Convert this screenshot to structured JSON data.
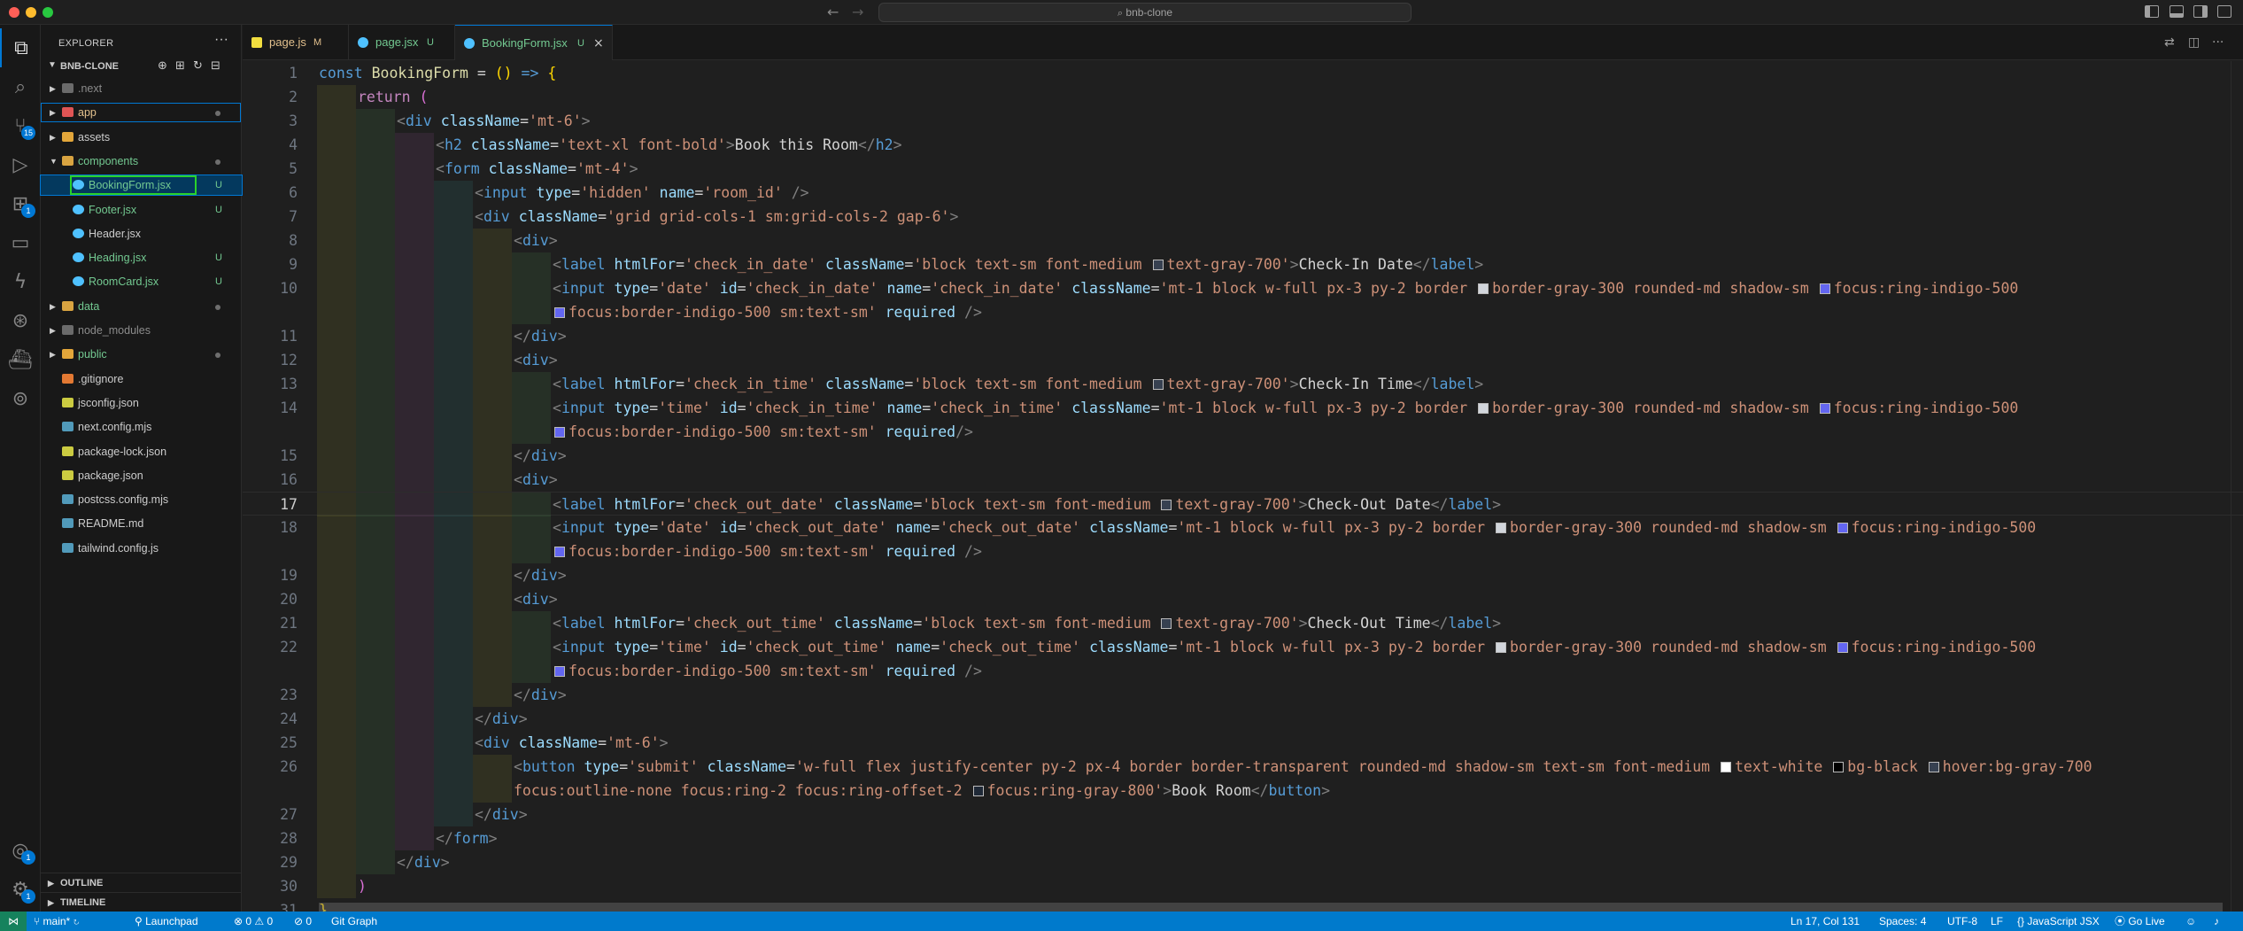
{
  "window": {
    "title": "bnb-clone"
  },
  "activity_bar": {
    "scm_badge": "15",
    "extensions_badge": "1",
    "accounts_badge": "1",
    "settings_badge": "1"
  },
  "explorer": {
    "title": "EXPLORER",
    "root": "BNB-CLONE",
    "items": [
      {
        "label": ".next",
        "type": "folder",
        "depth": 0,
        "expanded": false,
        "color": "#8b8b8b",
        "badge": "",
        "dot": false
      },
      {
        "label": "app",
        "type": "folder",
        "depth": 0,
        "expanded": false,
        "color": "#e2c08d",
        "badge": "",
        "dot": true
      },
      {
        "label": "assets",
        "type": "folder",
        "depth": 0,
        "expanded": false,
        "color": "#cccccc",
        "badge": "",
        "dot": false
      },
      {
        "label": "components",
        "type": "folder",
        "depth": 0,
        "expanded": true,
        "color": "#73c991",
        "badge": "",
        "dot": true
      },
      {
        "label": "BookingForm.jsx",
        "type": "file",
        "depth": 1,
        "color": "#73c991",
        "badge": "U",
        "dot": false
      },
      {
        "label": "Footer.jsx",
        "type": "file",
        "depth": 1,
        "color": "#73c991",
        "badge": "U",
        "dot": false
      },
      {
        "label": "Header.jsx",
        "type": "file",
        "depth": 1,
        "color": "#cccccc",
        "badge": "",
        "dot": false
      },
      {
        "label": "Heading.jsx",
        "type": "file",
        "depth": 1,
        "color": "#73c991",
        "badge": "U",
        "dot": false
      },
      {
        "label": "RoomCard.jsx",
        "type": "file",
        "depth": 1,
        "color": "#73c991",
        "badge": "U",
        "dot": false
      },
      {
        "label": "data",
        "type": "folder",
        "depth": 0,
        "expanded": false,
        "color": "#73c991",
        "badge": "",
        "dot": true
      },
      {
        "label": "node_modules",
        "type": "folder",
        "depth": 0,
        "expanded": false,
        "color": "#8b8b8b",
        "badge": "",
        "dot": false
      },
      {
        "label": "public",
        "type": "folder",
        "depth": 0,
        "expanded": false,
        "color": "#73c991",
        "badge": "",
        "dot": true
      },
      {
        "label": ".gitignore",
        "type": "file",
        "depth": 0,
        "color": "#cccccc",
        "badge": "",
        "dot": false
      },
      {
        "label": "jsconfig.json",
        "type": "file",
        "depth": 0,
        "color": "#cccccc",
        "badge": "",
        "dot": false
      },
      {
        "label": "next.config.mjs",
        "type": "file",
        "depth": 0,
        "color": "#cccccc",
        "badge": "",
        "dot": false
      },
      {
        "label": "package-lock.json",
        "type": "file",
        "depth": 0,
        "color": "#cccccc",
        "badge": "",
        "dot": false
      },
      {
        "label": "package.json",
        "type": "file",
        "depth": 0,
        "color": "#cccccc",
        "badge": "",
        "dot": false
      },
      {
        "label": "postcss.config.mjs",
        "type": "file",
        "depth": 0,
        "color": "#cccccc",
        "badge": "",
        "dot": false
      },
      {
        "label": "README.md",
        "type": "file",
        "depth": 0,
        "color": "#cccccc",
        "badge": "",
        "dot": false
      },
      {
        "label": "tailwind.config.js",
        "type": "file",
        "depth": 0,
        "color": "#cccccc",
        "badge": "",
        "dot": false
      }
    ],
    "outline": "OUTLINE",
    "timeline": "TIMELINE"
  },
  "tabs": [
    {
      "label": "page.js",
      "status": "M",
      "active": false
    },
    {
      "label": "page.jsx",
      "status": "U",
      "active": false
    },
    {
      "label": "BookingForm.jsx",
      "status": "U",
      "active": true
    }
  ],
  "editor": {
    "current_line": 17,
    "lines": [
      {
        "n": "1",
        "indent": 0,
        "html": "<span class='k'>const</span> <span class='fn'>BookingForm</span> <span class='tx'>=</span> <span class='br'>()</span> <span class='k'>=&gt;</span> <span class='br'>{</span>"
      },
      {
        "n": "2",
        "indent": 1,
        "html": "<span class='kc'>return</span> <span class='bp'>(</span>"
      },
      {
        "n": "3",
        "indent": 2,
        "html": "<span class='pu'>&lt;</span><span class='tg'>div</span> <span class='at'>className</span><span class='tx'>=</span><span class='st'>'mt-6'</span><span class='pu'>&gt;</span>"
      },
      {
        "n": "4",
        "indent": 3,
        "html": "<span class='pu'>&lt;</span><span class='tg'>h2</span> <span class='at'>className</span><span class='tx'>=</span><span class='st'>'text-xl font-bold'</span><span class='pu'>&gt;</span><span class='tx'>Book this Room</span><span class='pu'>&lt;/</span><span class='tg'>h2</span><span class='pu'>&gt;</span>"
      },
      {
        "n": "5",
        "indent": 3,
        "html": "<span class='pu'>&lt;</span><span class='tg'>form</span> <span class='at'>className</span><span class='tx'>=</span><span class='st'>'mt-4'</span><span class='pu'>&gt;</span>"
      },
      {
        "n": "6",
        "indent": 4,
        "html": "<span class='pu'>&lt;</span><span class='tg'>input</span> <span class='at'>type</span><span class='tx'>=</span><span class='st'>'hidden'</span> <span class='at'>name</span><span class='tx'>=</span><span class='st'>'room_id'</span> <span class='pu'>/&gt;</span>"
      },
      {
        "n": "7",
        "indent": 4,
        "html": "<span class='pu'>&lt;</span><span class='tg'>div</span> <span class='at'>className</span><span class='tx'>=</span><span class='st'>'grid grid-cols-1 sm:grid-cols-2 gap-6'</span><span class='pu'>&gt;</span>"
      },
      {
        "n": "8",
        "indent": 5,
        "html": "<span class='pu'>&lt;</span><span class='tg'>div</span><span class='pu'>&gt;</span>"
      },
      {
        "n": "9",
        "indent": 6,
        "html": "<span class='pu'>&lt;</span><span class='tg'>label</span> <span class='at'>htmlFor</span><span class='tx'>=</span><span class='st'>'check_in_date'</span> <span class='at'>className</span><span class='tx'>=</span><span class='st'>'block text-sm font-medium <span class='sw' style='background:#374151'></span>text-gray-700'</span><span class='pu'>&gt;</span><span class='tx'>Check-In Date</span><span class='pu'>&lt;/</span><span class='tg'>label</span><span class='pu'>&gt;</span>"
      },
      {
        "n": "10",
        "indent": 6,
        "html": "<span class='pu'>&lt;</span><span class='tg'>input</span> <span class='at'>type</span><span class='tx'>=</span><span class='st'>'date'</span> <span class='at'>id</span><span class='tx'>=</span><span class='st'>'check_in_date'</span> <span class='at'>name</span><span class='tx'>=</span><span class='st'>'check_in_date'</span> <span class='at'>className</span><span class='tx'>=</span><span class='st'>'mt-1 block w-full px-3 py-2 border <span class='sw' style='background:#d1d5db'></span>border-gray-300 rounded-md shadow-sm <span class='sw' style='background:#6366f1'></span>focus:ring-indigo-500</span>"
      },
      {
        "n": "",
        "indent": 6,
        "html": "<span class='st'><span class='sw' style='background:#6366f1'></span>focus:border-indigo-500 sm:text-sm'</span> <span class='at'>required</span> <span class='pu'>/&gt;</span>"
      },
      {
        "n": "11",
        "indent": 5,
        "html": "<span class='pu'>&lt;/</span><span class='tg'>div</span><span class='pu'>&gt;</span>"
      },
      {
        "n": "12",
        "indent": 5,
        "html": "<span class='pu'>&lt;</span><span class='tg'>div</span><span class='pu'>&gt;</span>"
      },
      {
        "n": "13",
        "indent": 6,
        "html": "<span class='pu'>&lt;</span><span class='tg'>label</span> <span class='at'>htmlFor</span><span class='tx'>=</span><span class='st'>'check_in_time'</span> <span class='at'>className</span><span class='tx'>=</span><span class='st'>'block text-sm font-medium <span class='sw' style='background:#374151'></span>text-gray-700'</span><span class='pu'>&gt;</span><span class='tx'>Check-In Time</span><span class='pu'>&lt;/</span><span class='tg'>label</span><span class='pu'>&gt;</span>"
      },
      {
        "n": "14",
        "indent": 6,
        "html": "<span class='pu'>&lt;</span><span class='tg'>input</span> <span class='at'>type</span><span class='tx'>=</span><span class='st'>'time'</span> <span class='at'>id</span><span class='tx'>=</span><span class='st'>'check_in_time'</span> <span class='at'>name</span><span class='tx'>=</span><span class='st'>'check_in_time'</span> <span class='at'>className</span><span class='tx'>=</span><span class='st'>'mt-1 block w-full px-3 py-2 border <span class='sw' style='background:#d1d5db'></span>border-gray-300 rounded-md shadow-sm <span class='sw' style='background:#6366f1'></span>focus:ring-indigo-500</span>"
      },
      {
        "n": "",
        "indent": 6,
        "html": "<span class='st'><span class='sw' style='background:#6366f1'></span>focus:border-indigo-500 sm:text-sm'</span> <span class='at'>required</span><span class='pu'>/&gt;</span>"
      },
      {
        "n": "15",
        "indent": 5,
        "html": "<span class='pu'>&lt;/</span><span class='tg'>div</span><span class='pu'>&gt;</span>"
      },
      {
        "n": "16",
        "indent": 5,
        "html": "<span class='pu'>&lt;</span><span class='tg'>div</span><span class='pu'>&gt;</span>"
      },
      {
        "n": "17",
        "indent": 6,
        "html": "<span class='pu'>&lt;</span><span class='tg'>label</span> <span class='at'>htmlFor</span><span class='tx'>=</span><span class='st'>'check_out_date'</span> <span class='at'>className</span><span class='tx'>=</span><span class='st'>'block text-sm font-medium <span class='sw' style='background:#374151'></span>text-gray-700'</span><span class='pu'>&gt;</span><span class='tx'>Check-Out Date</span><span class='pu'>&lt;/</span><span class='tg'>label</span><span class='pu'>&gt;</span>"
      },
      {
        "n": "18",
        "indent": 6,
        "html": "<span class='pu'>&lt;</span><span class='tg'>input</span> <span class='at'>type</span><span class='tx'>=</span><span class='st'>'date'</span> <span class='at'>id</span><span class='tx'>=</span><span class='st'>'check_out_date'</span> <span class='at'>name</span><span class='tx'>=</span><span class='st'>'check_out_date'</span> <span class='at'>className</span><span class='tx'>=</span><span class='st'>'mt-1 block w-full px-3 py-2 border <span class='sw' style='background:#d1d5db'></span>border-gray-300 rounded-md shadow-sm <span class='sw' style='background:#6366f1'></span>focus:ring-indigo-500</span>"
      },
      {
        "n": "",
        "indent": 6,
        "html": "<span class='st'><span class='sw' style='background:#6366f1'></span>focus:border-indigo-500 sm:text-sm'</span> <span class='at'>required</span> <span class='pu'>/&gt;</span>"
      },
      {
        "n": "19",
        "indent": 5,
        "html": "<span class='pu'>&lt;/</span><span class='tg'>div</span><span class='pu'>&gt;</span>"
      },
      {
        "n": "20",
        "indent": 5,
        "html": "<span class='pu'>&lt;</span><span class='tg'>div</span><span class='pu'>&gt;</span>"
      },
      {
        "n": "21",
        "indent": 6,
        "html": "<span class='pu'>&lt;</span><span class='tg'>label</span> <span class='at'>htmlFor</span><span class='tx'>=</span><span class='st'>'check_out_time'</span> <span class='at'>className</span><span class='tx'>=</span><span class='st'>'block text-sm font-medium <span class='sw' style='background:#374151'></span>text-gray-700'</span><span class='pu'>&gt;</span><span class='tx'>Check-Out Time</span><span class='pu'>&lt;/</span><span class='tg'>label</span><span class='pu'>&gt;</span>"
      },
      {
        "n": "22",
        "indent": 6,
        "html": "<span class='pu'>&lt;</span><span class='tg'>input</span> <span class='at'>type</span><span class='tx'>=</span><span class='st'>'time'</span> <span class='at'>id</span><span class='tx'>=</span><span class='st'>'check_out_time'</span> <span class='at'>name</span><span class='tx'>=</span><span class='st'>'check_out_time'</span> <span class='at'>className</span><span class='tx'>=</span><span class='st'>'mt-1 block w-full px-3 py-2 border <span class='sw' style='background:#d1d5db'></span>border-gray-300 rounded-md shadow-sm <span class='sw' style='background:#6366f1'></span>focus:ring-indigo-500</span>"
      },
      {
        "n": "",
        "indent": 6,
        "html": "<span class='st'><span class='sw' style='background:#6366f1'></span>focus:border-indigo-500 sm:text-sm'</span> <span class='at'>required</span> <span class='pu'>/&gt;</span>"
      },
      {
        "n": "23",
        "indent": 5,
        "html": "<span class='pu'>&lt;/</span><span class='tg'>div</span><span class='pu'>&gt;</span>"
      },
      {
        "n": "24",
        "indent": 4,
        "html": "<span class='pu'>&lt;/</span><span class='tg'>div</span><span class='pu'>&gt;</span>"
      },
      {
        "n": "25",
        "indent": 4,
        "html": "<span class='pu'>&lt;</span><span class='tg'>div</span> <span class='at'>className</span><span class='tx'>=</span><span class='st'>'mt-6'</span><span class='pu'>&gt;</span>"
      },
      {
        "n": "26",
        "indent": 5,
        "html": "<span class='pu'>&lt;</span><span class='tg'>button</span> <span class='at'>type</span><span class='tx'>=</span><span class='st'>'submit'</span> <span class='at'>className</span><span class='tx'>=</span><span class='st'>'w-full flex justify-center py-2 px-4 border border-transparent rounded-md shadow-sm text-sm font-medium <span class='sw' style='background:#ffffff'></span>text-white <span class='sw' style='background:#000000'></span>bg-black <span class='sw' style='background:#374151'></span>hover:bg-gray-700</span>"
      },
      {
        "n": "",
        "indent": 5,
        "html": "<span class='st'>focus:outline-none focus:ring-2 focus:ring-offset-2 <span class='sw' style='background:#1f2937'></span>focus:ring-gray-800'</span><span class='pu'>&gt;</span><span class='tx'>Book Room</span><span class='pu'>&lt;/</span><span class='tg'>button</span><span class='pu'>&gt;</span>"
      },
      {
        "n": "27",
        "indent": 4,
        "html": "<span class='pu'>&lt;/</span><span class='tg'>div</span><span class='pu'>&gt;</span>"
      },
      {
        "n": "28",
        "indent": 3,
        "html": "<span class='pu'>&lt;/</span><span class='tg'>form</span><span class='pu'>&gt;</span>"
      },
      {
        "n": "29",
        "indent": 2,
        "html": "<span class='pu'>&lt;/</span><span class='tg'>div</span><span class='pu'>&gt;</span>"
      },
      {
        "n": "30",
        "indent": 1,
        "html": "<span class='bp'>)</span>"
      },
      {
        "n": "31",
        "indent": 0,
        "html": "<span class='br'>}</span>"
      }
    ]
  },
  "status_bar": {
    "branch": "main*",
    "launchpad": "Launchpad",
    "errors": "0",
    "warnings": "0",
    "ports": "0",
    "git_graph": "Git Graph",
    "position": "Ln 17, Col 131",
    "spaces": "Spaces: 4",
    "encoding": "UTF-8",
    "eol": "LF",
    "language": "JavaScript JSX",
    "go_live": "Go Live"
  }
}
